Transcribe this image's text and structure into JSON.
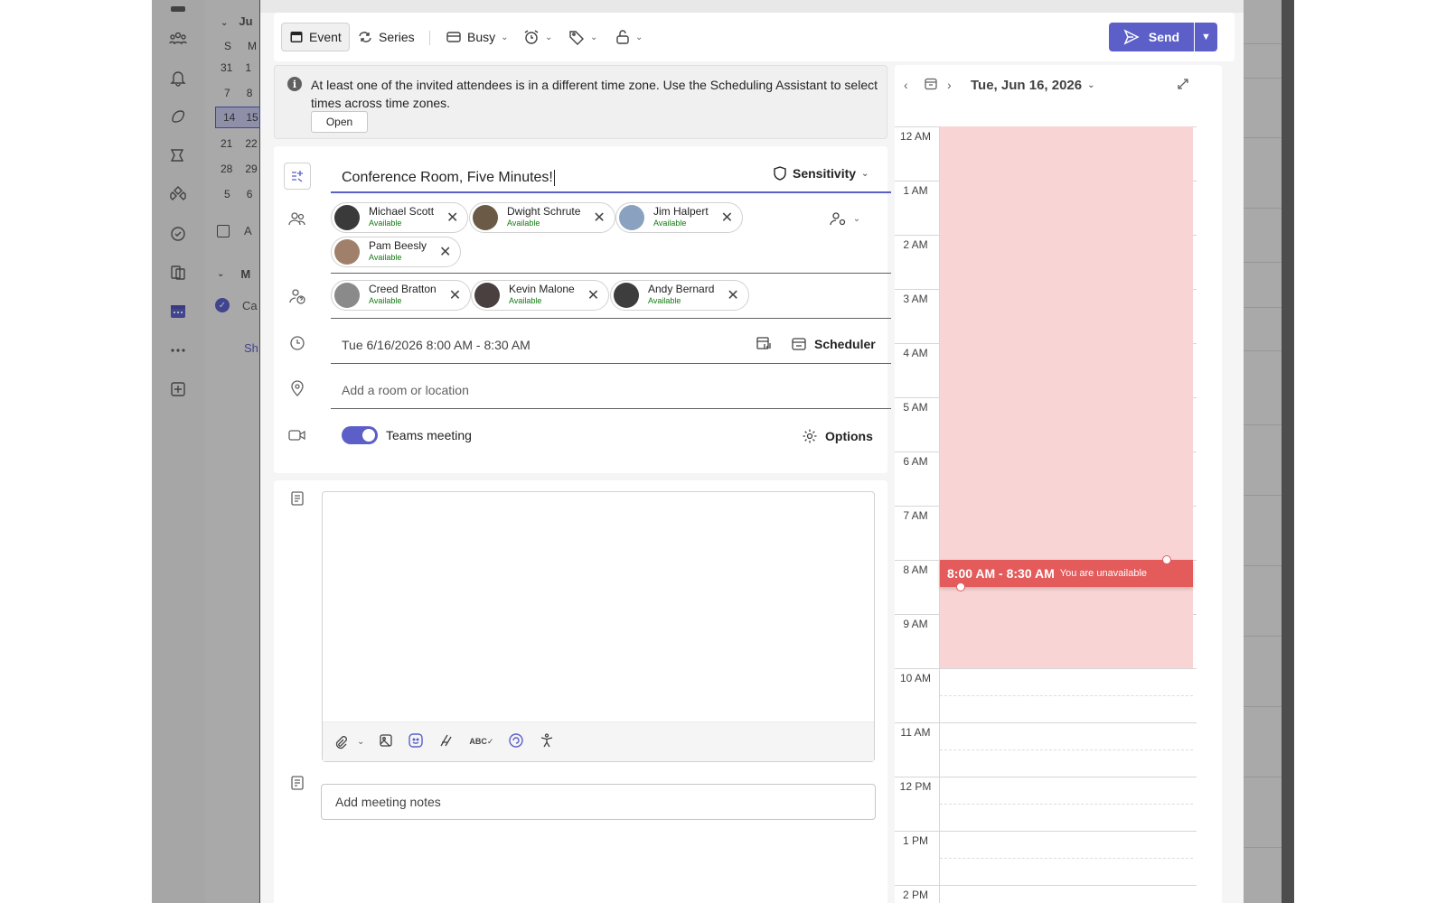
{
  "background": {
    "mini_calendar": {
      "month_partial": "Ju",
      "weekday_headers": [
        "S",
        "M"
      ],
      "rows": [
        [
          "31",
          "1"
        ],
        [
          "7",
          "8"
        ],
        [
          "14",
          "15"
        ],
        [
          "21",
          "22"
        ],
        [
          "28",
          "29"
        ],
        [
          "5",
          "6"
        ]
      ],
      "add_label_partial": "A",
      "section_partial": "M",
      "calendar_partial": "Ca",
      "show_partial": "Sh"
    }
  },
  "toolbar": {
    "event_label": "Event",
    "series_label": "Series",
    "busy_label": "Busy",
    "send_label": "Send"
  },
  "info_bar": {
    "message": "At least one of the invited attendees is in a different time zone. Use the Scheduling Assistant to select times across time zones.",
    "open_label": "Open"
  },
  "form": {
    "title_value": "Conference Room, Five Minutes!",
    "sensitivity_label": "Sensitivity",
    "required_attendees": [
      {
        "name": "Michael Scott",
        "status": "Available",
        "color": "#3a3a3a"
      },
      {
        "name": "Dwight Schrute",
        "status": "Available",
        "color": "#6b5a45"
      },
      {
        "name": "Jim Halpert",
        "status": "Available",
        "color": "#8aa2c0"
      },
      {
        "name": "Pam Beesly",
        "status": "Available",
        "color": "#a0806a"
      }
    ],
    "optional_attendees": [
      {
        "name": "Creed Bratton",
        "status": "Available",
        "color": "#8a8a8a"
      },
      {
        "name": "Kevin Malone",
        "status": "Available",
        "color": "#4a4040"
      },
      {
        "name": "Andy Bernard",
        "status": "Available",
        "color": "#3d3d3d"
      }
    ],
    "datetime_value": "Tue 6/16/2026 8:00 AM - 8:30 AM",
    "scheduler_label": "Scheduler",
    "location_placeholder": "Add a room or location",
    "teams_meeting_label": "Teams meeting",
    "teams_meeting_on": true,
    "options_label": "Options",
    "notes_placeholder": "Add meeting notes"
  },
  "calendar_pane": {
    "date_label": "Tue, Jun 16, 2026",
    "hours": [
      "12 AM",
      "1 AM",
      "2 AM",
      "3 AM",
      "4 AM",
      "5 AM",
      "6 AM",
      "7 AM",
      "8 AM",
      "9 AM",
      "10 AM",
      "11 AM",
      "12 PM",
      "1 PM",
      "2 PM"
    ],
    "event": {
      "time": "8:00 AM - 8:30 AM",
      "note": "You are unavailable",
      "color": "#e35b5b"
    },
    "unavailable_color": "#f9d4d4"
  },
  "colors": {
    "accent": "#5b5fc7",
    "available": "#107c10"
  }
}
